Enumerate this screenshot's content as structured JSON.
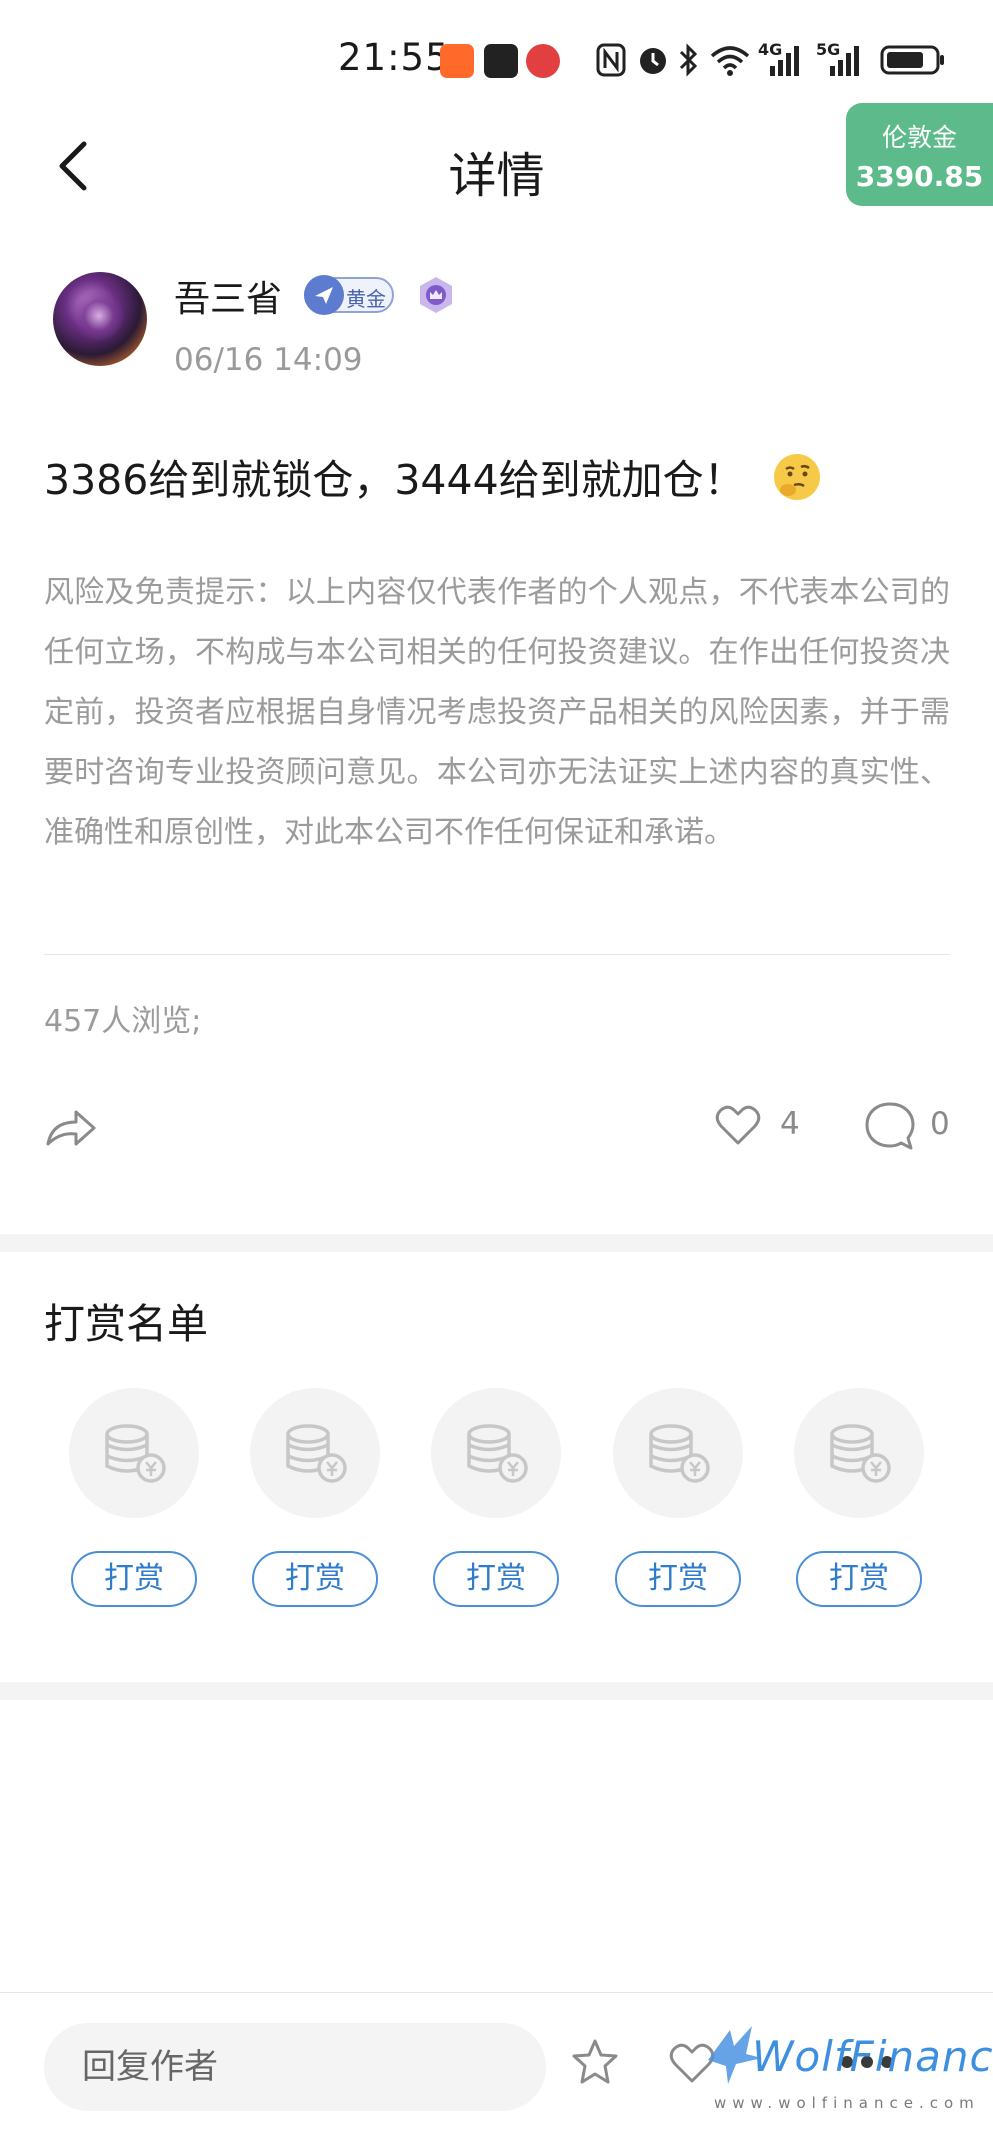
{
  "status_bar": {
    "time": "21:55",
    "network_4g": "4G",
    "network_5g": "5G"
  },
  "header": {
    "title": "详情",
    "coin_label": "伦敦金",
    "coin_value": "3390.85"
  },
  "author": {
    "name": "吾三省",
    "tier": "黄金",
    "timestamp": "06/16 14:09"
  },
  "post": {
    "title": "3386给到就锁仓，3444给到就加仓！",
    "emoji_icon": "thinking-face-icon",
    "disclaimer": "风险及免责提示：以上内容仅代表作者的个人观点，不代表本公司的任何立场，不构成与本公司相关的任何投资建议。在作出任何投资决定前，投资者应根据自身情况考虑投资产品相关的风险因素，并于需要时咨询专业投资顾问意见。本公司亦无法证实上述内容的真实性、准确性和原创性，对此本公司不作任何保证和承诺。",
    "views": "457人浏览;",
    "likes": "4",
    "comments": "0"
  },
  "rewards": {
    "title": "打赏名单",
    "slots": [
      {
        "button": "打赏"
      },
      {
        "button": "打赏"
      },
      {
        "button": "打赏"
      },
      {
        "button": "打赏"
      },
      {
        "button": "打赏"
      }
    ]
  },
  "bottom_bar": {
    "reply_placeholder": "回复作者"
  },
  "watermark": {
    "brand": "WolfFinance",
    "url": "www.wolfinance.com"
  },
  "colors": {
    "accent_green": "#5dbb8b",
    "button_blue": "#2f7bcc",
    "muted_text": "#9b9b9b"
  }
}
